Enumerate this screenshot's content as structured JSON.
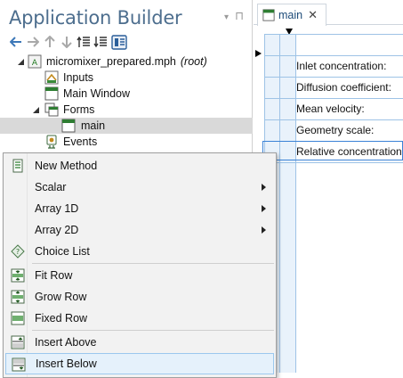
{
  "builder": {
    "title": "Application Builder",
    "tree": {
      "root": {
        "label": "micromixer_prepared.mph",
        "note": "(root)"
      },
      "inputs": "Inputs",
      "main_window": "Main Window",
      "forms": "Forms",
      "main": "main",
      "events": "Events"
    }
  },
  "editor": {
    "tab_label": "main",
    "rows": [
      "Inlet concentration:",
      "Diffusion coefficient:",
      "Mean velocity:",
      "Geometry scale:",
      "Relative concentration"
    ]
  },
  "menu": {
    "items": [
      {
        "label": "New Method"
      },
      {
        "label": "Scalar"
      },
      {
        "label": "Array 1D"
      },
      {
        "label": "Array 2D"
      },
      {
        "label": "Choice List"
      },
      {
        "label": "Fit Row"
      },
      {
        "label": "Grow Row"
      },
      {
        "label": "Fixed Row"
      },
      {
        "label": "Insert Above"
      },
      {
        "label": "Insert Below"
      }
    ],
    "highlighted": "Insert Below"
  },
  "colors": {
    "accent": "#4d6e8e",
    "grid_fill": "#e9f2fb",
    "grid_line": "#9ec3e6",
    "selection": "#d9d9d9",
    "menu_bg": "#f2f2f2",
    "hover_bg": "#e5f1fb"
  }
}
